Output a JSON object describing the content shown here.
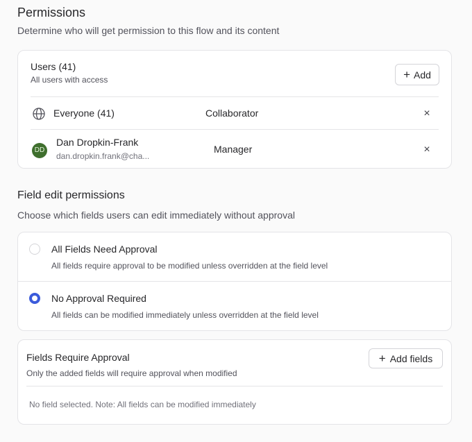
{
  "permissions": {
    "title": "Permissions",
    "description": "Determine who will get permission to this flow and its content"
  },
  "users": {
    "title": "Users (41)",
    "subtitle": "All users with access",
    "add_label": "Add",
    "rows": [
      {
        "name": "Everyone (41)",
        "role": "Collaborator",
        "icon": "globe-icon"
      },
      {
        "name": "Dan Dropkin-Frank",
        "email": "dan.dropkin.frank@cha...",
        "initials": "DD",
        "role": "Manager",
        "avatar_color": "#3f6f2e"
      }
    ],
    "remove_glyph": "×"
  },
  "field_edit": {
    "title": "Field edit permissions",
    "description": "Choose which fields users can edit immediately without approval",
    "options": [
      {
        "title": "All Fields Need Approval",
        "description": "All fields require approval to be modified unless overridden at the field level",
        "selected": false
      },
      {
        "title": "No Approval Required",
        "description": "All fields can be modified immediately unless overridden at the field level",
        "selected": true
      }
    ],
    "accent_color": "#3b5bdb"
  },
  "fields_require": {
    "title": "Fields Require Approval",
    "subtitle": "Only the added fields will require approval when modified",
    "add_label": "Add fields",
    "empty_note": "No field selected. Note: All fields can be modified immediately"
  }
}
